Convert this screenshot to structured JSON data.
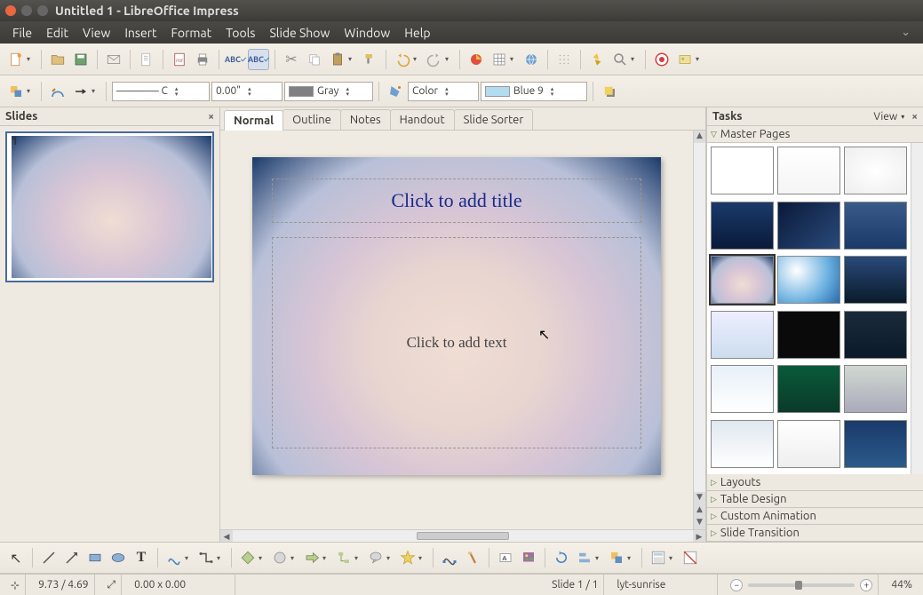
{
  "window": {
    "title": "Untitled 1 - LibreOffice Impress"
  },
  "menu": {
    "items": [
      "File",
      "Edit",
      "View",
      "Insert",
      "Format",
      "Tools",
      "Slide Show",
      "Window",
      "Help"
    ]
  },
  "toolbar2": {
    "line_style": "———— C",
    "line_width": "0.00\"",
    "line_color": "Gray",
    "fill_type": "Color",
    "fill_color": "Blue 9",
    "gray_hex": "#808080",
    "blue9_hex": "#b4dcf0"
  },
  "slides_panel": {
    "title": "Slides",
    "thumb_number": "1"
  },
  "view_tabs": [
    "Normal",
    "Outline",
    "Notes",
    "Handout",
    "Slide Sorter"
  ],
  "slide": {
    "title_placeholder": "Click to add title",
    "text_placeholder": "Click to add text"
  },
  "tasks_panel": {
    "title": "Tasks",
    "view_label": "View",
    "sections": [
      "Master Pages",
      "Layouts",
      "Table Design",
      "Custom Animation",
      "Slide Transition"
    ]
  },
  "status": {
    "coords": "9.73 / 4.69",
    "size": "0.00 x 0.00",
    "slide": "Slide 1 / 1",
    "layout": "lyt-sunrise",
    "zoom": "44%"
  }
}
